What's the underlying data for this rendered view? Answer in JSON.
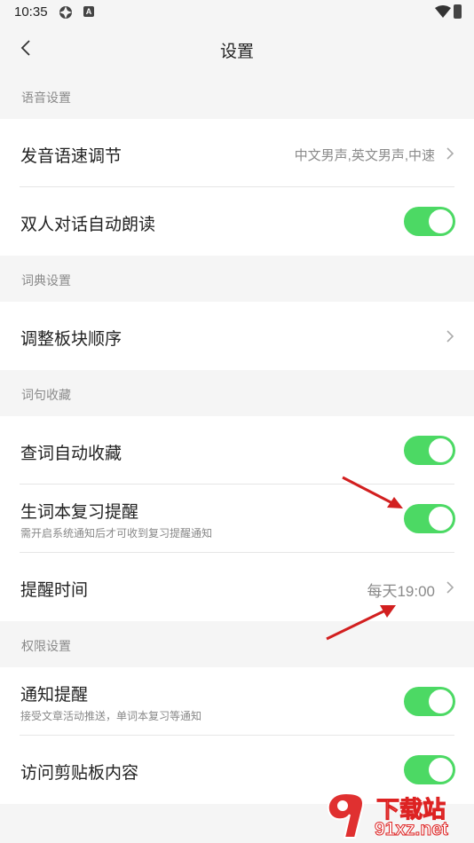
{
  "status": {
    "time": "10:35",
    "a_badge": "A"
  },
  "appbar": {
    "title": "设置"
  },
  "sections": {
    "voice": {
      "header": "语音设置"
    },
    "dict": {
      "header": "词典设置"
    },
    "collect": {
      "header": "词句收藏"
    },
    "perm": {
      "header": "权限设置"
    }
  },
  "rows": {
    "pronounce": {
      "label": "发音语速调节",
      "value": "中文男声,英文男声,中速"
    },
    "dialog": {
      "label": "双人对话自动朗读",
      "on": true
    },
    "order": {
      "label": "调整板块顺序"
    },
    "auto_collect": {
      "label": "查词自动收藏",
      "on": true
    },
    "review": {
      "label": "生词本复习提醒",
      "sub": "需开启系统通知后才可收到复习提醒通知",
      "on": true
    },
    "remind_time": {
      "label": "提醒时间",
      "value": "每天19:00"
    },
    "notify": {
      "label": "通知提醒",
      "sub": "接受文章活动推送，单词本复习等通知",
      "on": true
    },
    "clipboard": {
      "label": "访问剪贴板内容",
      "on": true
    }
  },
  "watermark": {
    "line1": "下载站",
    "line2": "91xz.net"
  },
  "colors": {
    "toggle_on": "#4cd964",
    "annotation_arrow": "#d21f1f"
  }
}
